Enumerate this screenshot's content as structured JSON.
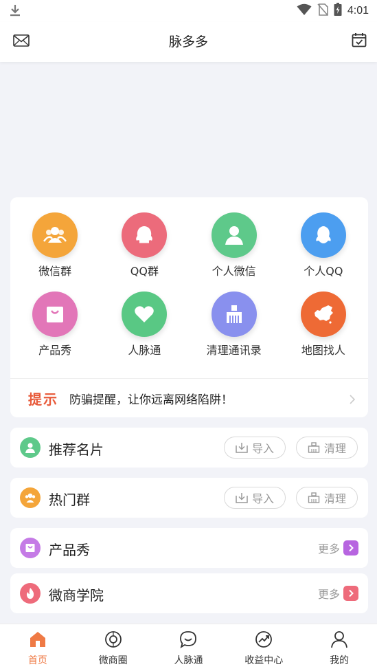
{
  "status_bar": {
    "time": "4:01"
  },
  "header": {
    "title": "脉多多"
  },
  "grid": [
    {
      "label": "微信群",
      "color": "#f4a53a",
      "icon": "users-icon"
    },
    {
      "label": "QQ群",
      "color": "#ec6b7b",
      "icon": "qq-group-icon"
    },
    {
      "label": "个人微信",
      "color": "#5ec98a",
      "icon": "person-icon"
    },
    {
      "label": "个人QQ",
      "color": "#4c9ef0",
      "icon": "qq-icon"
    },
    {
      "label": "产品秀",
      "color": "#e276b8",
      "icon": "shopping-bag-icon"
    },
    {
      "label": "人脉通",
      "color": "#59c884",
      "icon": "heart-icon"
    },
    {
      "label": "清理通讯录",
      "color": "#8990ee",
      "icon": "broom-icon"
    },
    {
      "label": "地图找人",
      "color": "#ee6a35",
      "icon": "china-map-icon"
    }
  ],
  "tip": {
    "tag": "提示",
    "message": "防骗提醒，让你远离网络陷阱！"
  },
  "rows": [
    {
      "name": "推荐名片",
      "color": "#5ec98a",
      "import_label": "导入",
      "clean_label": "清理"
    },
    {
      "name": "热门群",
      "color": "#f4a53a",
      "import_label": "导入",
      "clean_label": "清理"
    },
    {
      "name": "产品秀",
      "color": "#c57be6",
      "more_label": "更多",
      "arrow_color": "#b765e0"
    },
    {
      "name": "微商学院",
      "color": "#ee6b7b",
      "more_label": "更多",
      "arrow_color": "#ee6b7b"
    }
  ],
  "tabs": [
    {
      "label": "首页",
      "icon": "home-icon",
      "active": true
    },
    {
      "label": "微商圈",
      "icon": "compass-icon",
      "active": false
    },
    {
      "label": "人脉通",
      "icon": "chat-icon",
      "active": false
    },
    {
      "label": "收益中心",
      "icon": "trend-icon",
      "active": false
    },
    {
      "label": "我的",
      "icon": "user-icon",
      "active": false
    }
  ],
  "colors": {
    "accent": "#ef7a45",
    "tip_tag": "#e85a3a"
  }
}
